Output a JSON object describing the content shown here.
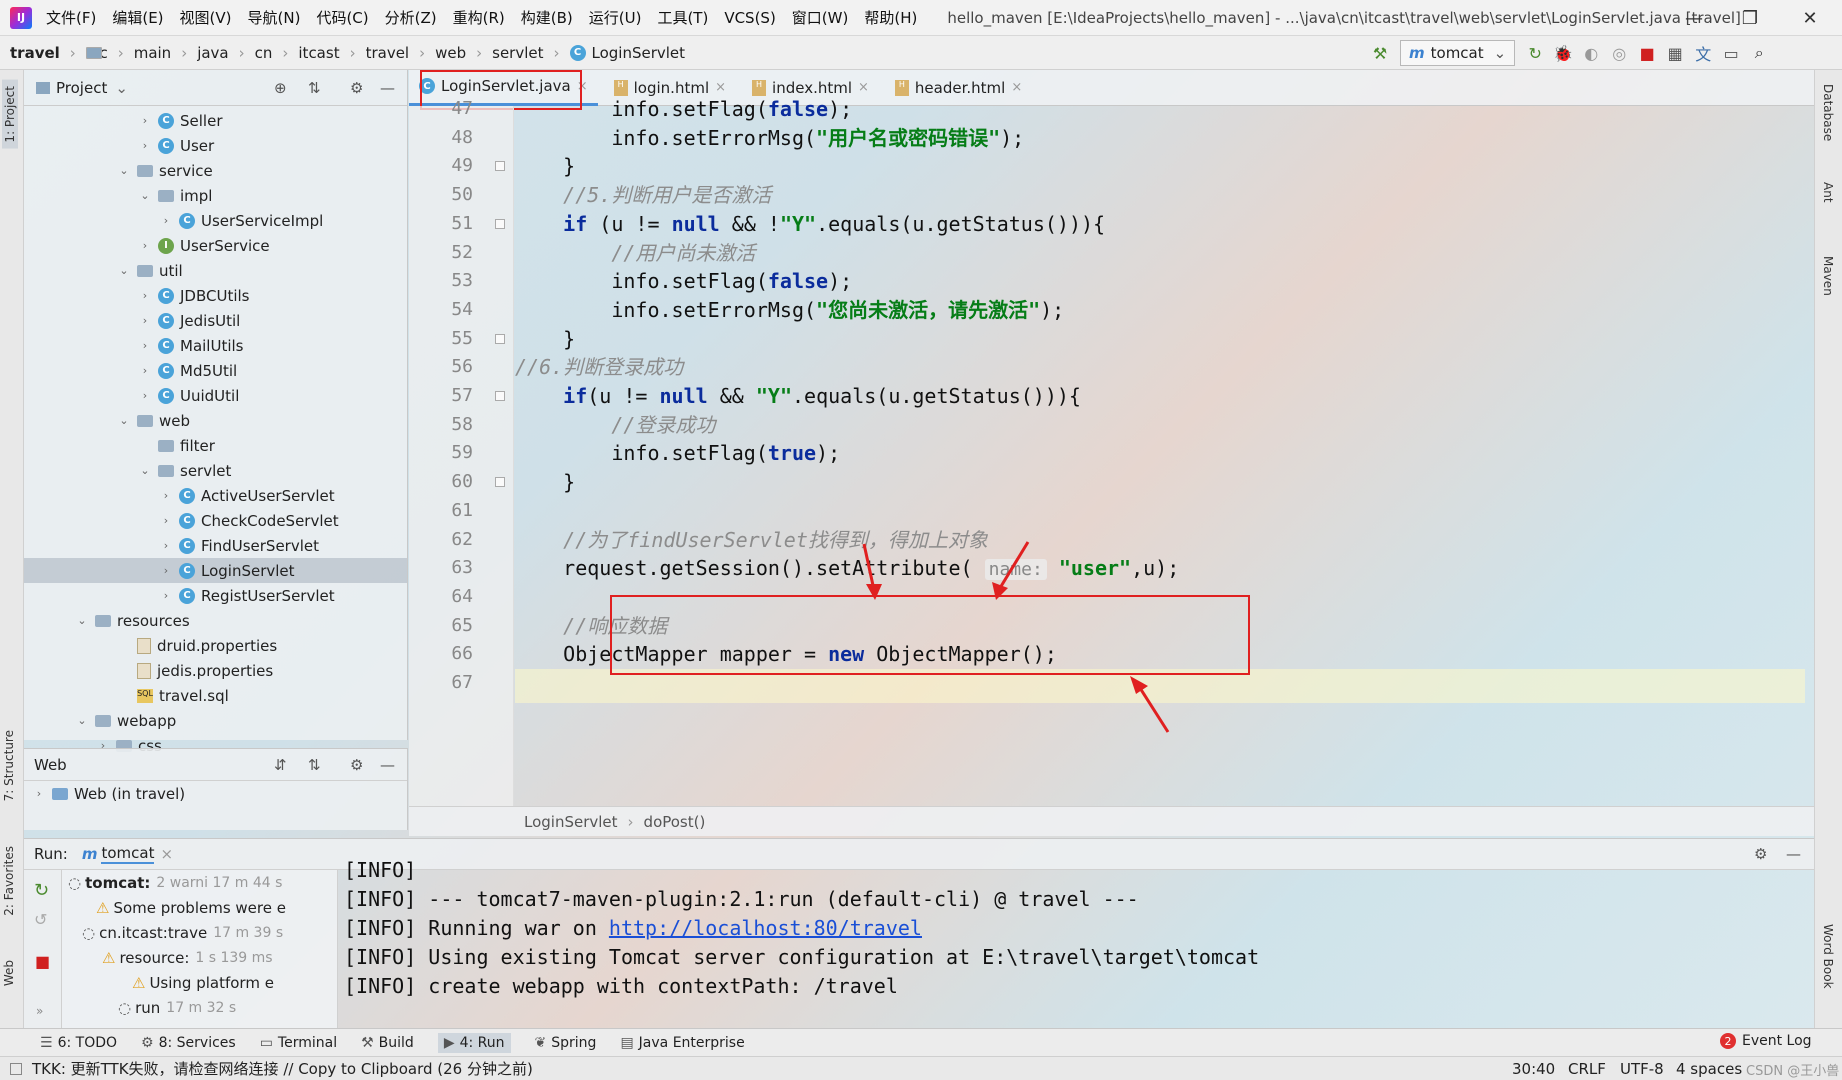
{
  "titlebar": {
    "logo": "IJ",
    "menu": [
      "文件(F)",
      "编辑(E)",
      "视图(V)",
      "导航(N)",
      "代码(C)",
      "分析(Z)",
      "重构(R)",
      "构建(B)",
      "运行(U)",
      "工具(T)",
      "VCS(S)",
      "窗口(W)",
      "帮助(H)"
    ],
    "title": "hello_maven [E:\\IdeaProjects\\hello_maven] - ...\\java\\cn\\itcast\\travel\\web\\servlet\\LoginServlet.java [travel]",
    "minimize": "—",
    "restore": "❐",
    "close": "✕"
  },
  "navbar": {
    "crumbs": [
      "travel",
      "src",
      "main",
      "java",
      "cn",
      "itcast",
      "travel",
      "web",
      "servlet",
      "LoginServlet"
    ],
    "run_config": "tomcat"
  },
  "left_stripe": {
    "project": "1: Project",
    "structure": "7: Structure",
    "favorites": "2: Favorites",
    "web": "Web"
  },
  "right_stripe": {
    "database": "Database",
    "ant": "Ant",
    "maven": "Maven",
    "wordbook": "Word Book"
  },
  "project_panel": {
    "title": "Project",
    "tree": [
      {
        "label": "Seller",
        "indent": 6,
        "icon": "class",
        "arrow": "›"
      },
      {
        "label": "User",
        "indent": 6,
        "icon": "class",
        "arrow": "›"
      },
      {
        "label": "service",
        "indent": 5,
        "icon": "folder",
        "arrow": "⌄"
      },
      {
        "label": "impl",
        "indent": 6,
        "icon": "folder",
        "arrow": "⌄"
      },
      {
        "label": "UserServiceImpl",
        "indent": 7,
        "icon": "class",
        "arrow": "›"
      },
      {
        "label": "UserService",
        "indent": 6,
        "icon": "interface",
        "arrow": "›"
      },
      {
        "label": "util",
        "indent": 5,
        "icon": "folder",
        "arrow": "⌄"
      },
      {
        "label": "JDBCUtils",
        "indent": 6,
        "icon": "class",
        "arrow": "›"
      },
      {
        "label": "JedisUtil",
        "indent": 6,
        "icon": "class",
        "arrow": "›"
      },
      {
        "label": "MailUtils",
        "indent": 6,
        "icon": "class",
        "arrow": "›"
      },
      {
        "label": "Md5Util",
        "indent": 6,
        "icon": "class",
        "arrow": "›"
      },
      {
        "label": "UuidUtil",
        "indent": 6,
        "icon": "class",
        "arrow": "›"
      },
      {
        "label": "web",
        "indent": 5,
        "icon": "folder",
        "arrow": "⌄"
      },
      {
        "label": "filter",
        "indent": 6,
        "icon": "folder",
        "arrow": ""
      },
      {
        "label": "servlet",
        "indent": 6,
        "icon": "folder",
        "arrow": "⌄"
      },
      {
        "label": "ActiveUserServlet",
        "indent": 7,
        "icon": "class",
        "arrow": "›"
      },
      {
        "label": "CheckCodeServlet",
        "indent": 7,
        "icon": "class",
        "arrow": "›"
      },
      {
        "label": "FindUserServlet",
        "indent": 7,
        "icon": "class",
        "arrow": "›"
      },
      {
        "label": "LoginServlet",
        "indent": 7,
        "icon": "class",
        "arrow": "›",
        "selected": true
      },
      {
        "label": "RegistUserServlet",
        "indent": 7,
        "icon": "class",
        "arrow": "›"
      },
      {
        "label": "resources",
        "indent": 3,
        "icon": "folder",
        "arrow": "⌄"
      },
      {
        "label": "druid.properties",
        "indent": 5,
        "icon": "file",
        "arrow": ""
      },
      {
        "label": "jedis.properties",
        "indent": 5,
        "icon": "file",
        "arrow": ""
      },
      {
        "label": "travel.sql",
        "indent": 5,
        "icon": "sql",
        "arrow": ""
      },
      {
        "label": "webapp",
        "indent": 3,
        "icon": "folder",
        "arrow": "⌄"
      },
      {
        "label": "css",
        "indent": 4,
        "icon": "folder",
        "arrow": "›"
      }
    ]
  },
  "web_panel": {
    "title": "Web",
    "item": "Web (in travel)"
  },
  "tabs": [
    {
      "label": "LoginServlet.java",
      "type": "java",
      "active": true
    },
    {
      "label": "login.html",
      "type": "html"
    },
    {
      "label": "index.html",
      "type": "html"
    },
    {
      "label": "header.html",
      "type": "html"
    }
  ],
  "editor": {
    "lines": [
      {
        "n": "47",
        "html": "        info.setFlag(<span class='kw'>false</span>);"
      },
      {
        "n": "48",
        "html": "        info.setErrorMsg(<span class='str'>\"用户名或密码错误\"</span>);"
      },
      {
        "n": "49",
        "html": "    }"
      },
      {
        "n": "50",
        "html": "    <span class='cm'>//5.判断用户是否激活</span>"
      },
      {
        "n": "51",
        "html": "    <span class='kw'>if</span> (u != <span class='kw'>null</span> &amp;&amp; !<span class='str'>\"Y\"</span>.equals(u.getStatus())){"
      },
      {
        "n": "52",
        "html": "        <span class='cm'>//用户尚未激活</span>"
      },
      {
        "n": "53",
        "html": "        info.setFlag(<span class='kw'>false</span>);"
      },
      {
        "n": "54",
        "html": "        info.setErrorMsg(<span class='str'>\"您尚未激活，请先激活\"</span>);"
      },
      {
        "n": "55",
        "html": "    }"
      },
      {
        "n": "56",
        "html": "<span class='cm'>//6.判断登录成功</span>"
      },
      {
        "n": "57",
        "html": "    <span class='kw'>if</span>(u != <span class='kw'>null</span> &amp;&amp; <span class='str'>\"Y\"</span>.equals(u.getStatus())){"
      },
      {
        "n": "58",
        "html": "        <span class='cm'>//登录成功</span>"
      },
      {
        "n": "59",
        "html": "        info.setFlag(<span class='kw'>true</span>);"
      },
      {
        "n": "60",
        "html": "    }"
      },
      {
        "n": "61",
        "html": ""
      },
      {
        "n": "62",
        "html": "    <span class='cm'>//为了findUserServlet找得到，得加上对象</span>"
      },
      {
        "n": "63",
        "html": "    request.getSession().setAttribute( <span class='hint'>name:</span> <span class='str'>\"user\"</span>,u);"
      },
      {
        "n": "64",
        "html": ""
      },
      {
        "n": "65",
        "html": "    <span class='cm'>//响应数据</span>"
      },
      {
        "n": "66",
        "html": "    ObjectMapper mapper = <span class='kw'>new</span> ObjectMapper();"
      },
      {
        "n": "67",
        "html": ""
      }
    ],
    "breadcrumb_class": "LoginServlet",
    "breadcrumb_method": "doPost()"
  },
  "run_panel": {
    "label": "Run:",
    "tab": "tomcat",
    "tree": [
      {
        "label": "tomcat:",
        "meta": "2 warni 17 m 44 s",
        "bold": true
      },
      {
        "label": "Some problems were e",
        "meta": "",
        "warn": true
      },
      {
        "label": "cn.itcast:trave",
        "meta": "17 m 39 s"
      },
      {
        "label": "resource:",
        "meta": "1 s 139 ms",
        "warn": true
      },
      {
        "label": "Using platform e",
        "meta": "",
        "warn": true
      },
      {
        "label": "run",
        "meta": "17 m 32 s"
      }
    ],
    "console": [
      {
        "text": "[INFO]"
      },
      {
        "text": "[INFO] --- tomcat7-maven-plugin:2.1:run (default-cli) @ travel ---"
      },
      {
        "text": "[INFO] Running war on ",
        "link": "http://localhost:80/travel"
      },
      {
        "text": "[INFO] Using existing Tomcat server configuration at E:\\travel\\target\\tomcat"
      },
      {
        "text": "[INFO] create webapp with contextPath: /travel"
      }
    ]
  },
  "bottom_tools": [
    {
      "label": "6: TODO"
    },
    {
      "label": "8: Services"
    },
    {
      "label": "Terminal"
    },
    {
      "label": "Build"
    },
    {
      "label": "4: Run",
      "active": true
    },
    {
      "label": "Spring"
    },
    {
      "label": "Java Enterprise"
    }
  ],
  "event_log": {
    "count": "2",
    "label": "Event Log"
  },
  "status": {
    "message": "TKK: 更新TTK失败，请检查网络连接 // Copy to Clipboard (26 分钟之前)",
    "position": "30:40",
    "line_sep": "CRLF",
    "encoding": "UTF-8",
    "indent": "4 spaces",
    "watermark": "CSDN @王小兽"
  },
  "colors": {
    "keyword": "#0b2c9c",
    "string": "#067d17",
    "comment": "#8c8c8c",
    "highlight_box": "#e02020"
  }
}
